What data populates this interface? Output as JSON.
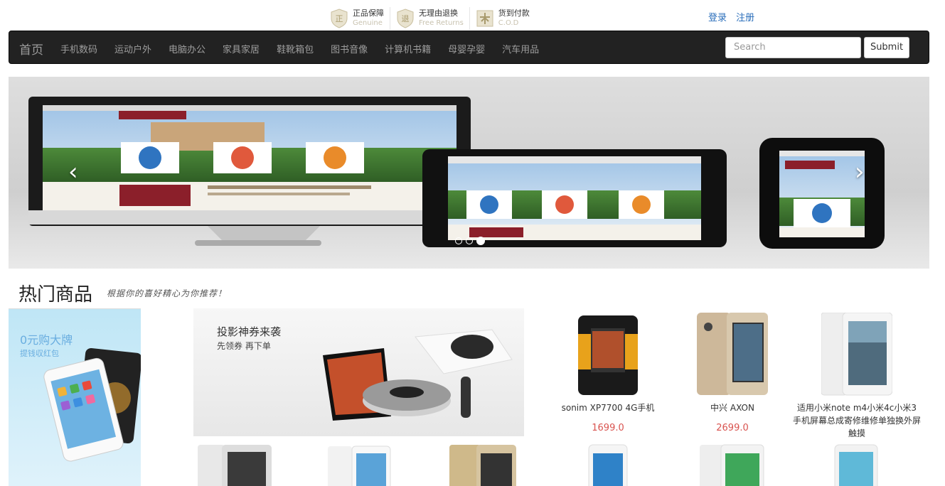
{
  "badges": [
    {
      "icon": "genuine-icon",
      "title": "正品保障",
      "sub": "Genuine"
    },
    {
      "icon": "return-icon",
      "title": "无理由退换",
      "sub": "Free Returns"
    },
    {
      "icon": "cod-icon",
      "title": "货到付款",
      "sub": "C.O.D"
    }
  ],
  "user_links": {
    "login": "登录",
    "register": "注册"
  },
  "navbar": {
    "brand": "首页",
    "items": [
      "手机数码",
      "运动户外",
      "电脑办公",
      "家具家居",
      "鞋靴箱包",
      "图书音像",
      "计算机书籍",
      "母婴孕婴",
      "汽车用品"
    ],
    "search_placeholder": "Search",
    "submit_label": "Submit"
  },
  "carousel": {
    "slide_count": 3,
    "active_index": 2,
    "prev": "‹",
    "next": "›"
  },
  "hot": {
    "title": "热门商品",
    "slogan": "根据你的喜好精心为你推荐！"
  },
  "promo_left": {
    "title": "0元购大牌",
    "subtitle": "提钱収红包"
  },
  "promo_mid": {
    "title": "投影神券来袭",
    "subtitle": "先领券 再下单"
  },
  "products": [
    {
      "name": "sonim XP7700 4G手机",
      "price": "1699.0"
    },
    {
      "name": "中兴 AXON",
      "price": "2699.0"
    },
    {
      "name": "适用小米note m4小米4c小米3手机屏幕总成寄修维修单独换外屏触摸",
      "price": ""
    }
  ],
  "colors": {
    "navbar_bg": "#222222",
    "link": "#2a6ebb",
    "price": "#d9534f"
  }
}
